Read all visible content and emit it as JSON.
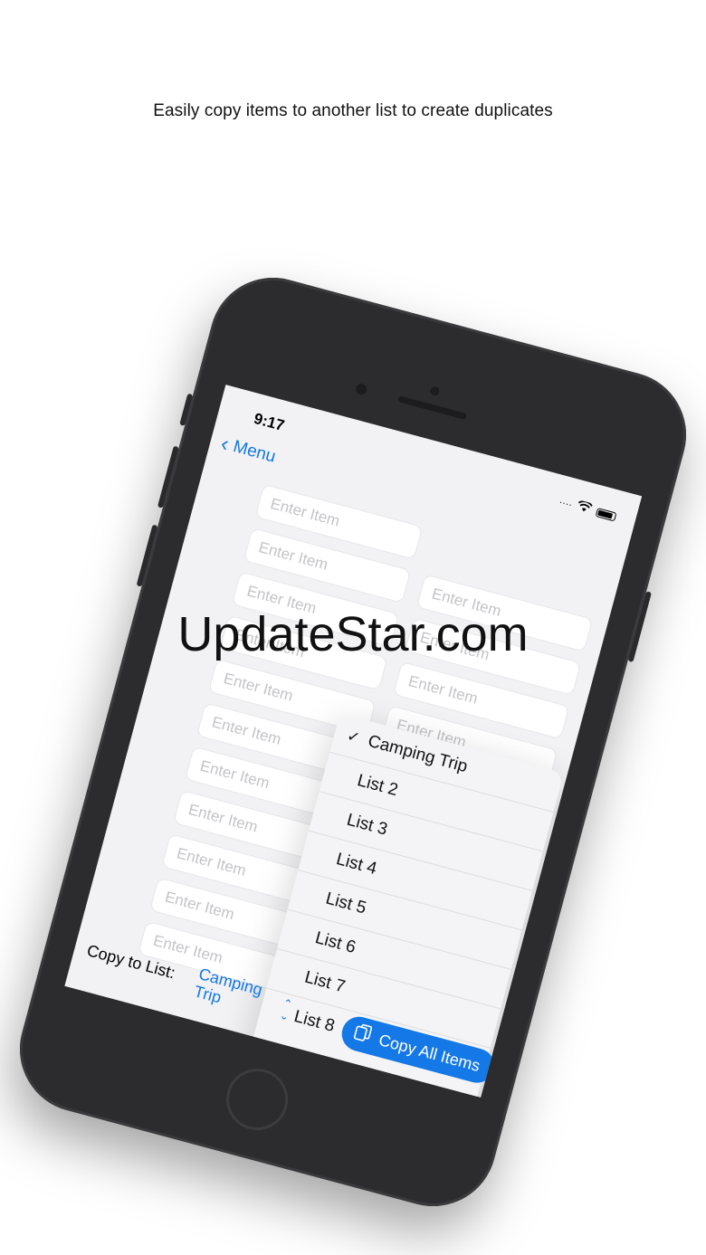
{
  "caption": "Easily copy items to another list to create duplicates",
  "status_bar": {
    "time": "9:17"
  },
  "nav": {
    "back_label": "Menu"
  },
  "item_placeholder": "Enter Item",
  "menu": {
    "items": [
      {
        "label": "Camping Trip",
        "checked": true
      },
      {
        "label": "List 2",
        "checked": false
      },
      {
        "label": "List 3",
        "checked": false
      },
      {
        "label": "List 4",
        "checked": false
      },
      {
        "label": "List 5",
        "checked": false
      },
      {
        "label": "List 6",
        "checked": false
      },
      {
        "label": "List 7",
        "checked": false
      },
      {
        "label": "List 8",
        "checked": false
      }
    ],
    "checkmark": "✓"
  },
  "footer": {
    "copy_to_label": "Copy to List:",
    "selected_list": "Camping Trip",
    "copy_all_label": "Copy All Items"
  },
  "watermark": "UpdateStar.com",
  "colors": {
    "accent": "#1478e6",
    "phone_body": "#2c2c2e",
    "screen_bg": "#f2f2f4"
  },
  "icons": [
    "back-chevron-icon",
    "wifi-icon",
    "battery-icon",
    "checkmark-icon",
    "up-down-chevron-icon",
    "copy-document-icon"
  ]
}
